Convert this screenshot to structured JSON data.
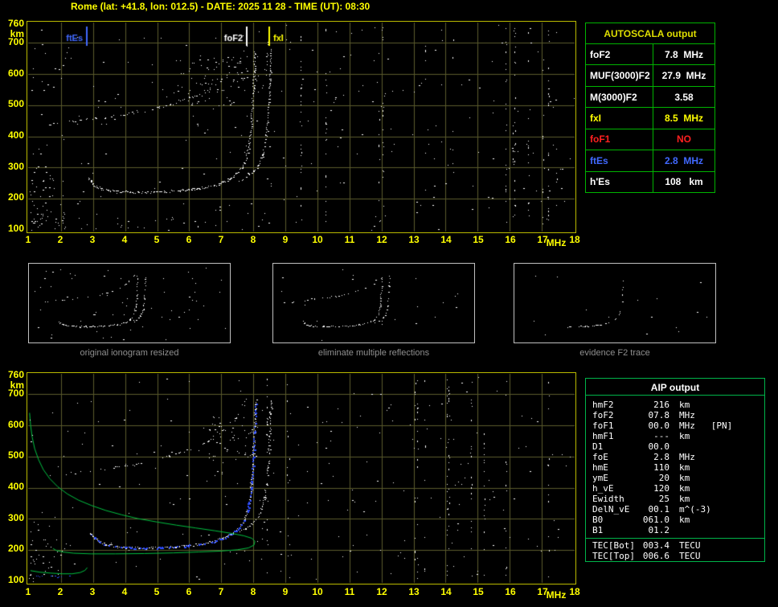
{
  "header": {
    "title": "Rome (lat: +41.8, lon: 012.5) - DATE: 2025 11 28 - TIME (UT): 08:30"
  },
  "autoscala": {
    "title": "AUTOSCALA output",
    "border_color": "#00b400",
    "rows": [
      {
        "label": "foF2",
        "value": "7.8  MHz",
        "color": "#ffffff"
      },
      {
        "label": "MUF(3000)F2",
        "value": "27.9  MHz",
        "color": "#ffffff"
      },
      {
        "label": "M(3000)F2",
        "value": "3.58",
        "color": "#ffffff"
      },
      {
        "label": "fxI",
        "value": "8.5  MHz",
        "color": "#ffff00"
      },
      {
        "label": "foF1",
        "value": "NO",
        "color": "#ff2020"
      },
      {
        "label": "ftEs",
        "value": "2.8  MHz",
        "color": "#4169ff"
      },
      {
        "label": "h'Es",
        "value": "108   km",
        "color": "#ffffff"
      }
    ]
  },
  "thumbnails": {
    "captions": [
      "original ionogram resized",
      "eliminate multiple reflections",
      "evidence F2 trace"
    ]
  },
  "aip": {
    "title": "AIP output",
    "border_color": "#00b44a",
    "rows": [
      {
        "label": "hmF2",
        "value": "216",
        "unit": "km"
      },
      {
        "label": "foF2",
        "value": "07.8",
        "unit": "MHz"
      },
      {
        "label": "foF1",
        "value": "00.0",
        "unit": "MHz   [PN]"
      },
      {
        "label": "hmF1",
        "value": "---",
        "unit": "km"
      },
      {
        "label": "D1",
        "value": "00.0",
        "unit": ""
      },
      {
        "label": "foE",
        "value": "2.8",
        "unit": "MHz"
      },
      {
        "label": "hmE",
        "value": "110",
        "unit": "km"
      },
      {
        "label": "ymE",
        "value": "20",
        "unit": "km"
      },
      {
        "label": "h_vE",
        "value": "120",
        "unit": "km"
      },
      {
        "label": "Ewidth",
        "value": "25",
        "unit": "km"
      },
      {
        "label": "DelN_vE",
        "value": "00.1",
        "unit": "m^(-3)"
      },
      {
        "label": "B0",
        "value": "061.0",
        "unit": "km"
      },
      {
        "label": "B1",
        "value": "01.2",
        "unit": ""
      }
    ],
    "tec_rows": [
      {
        "label": "TEC[Bot]",
        "value": "003.4",
        "unit": "TECU"
      },
      {
        "label": "TEC[Top]",
        "value": "006.6",
        "unit": "TECU"
      }
    ]
  },
  "chart_data": {
    "type": "scatter",
    "title": "ionogram virtual height vs frequency",
    "axes": {
      "xlim": [
        1,
        18
      ],
      "ylim": [
        100,
        760
      ],
      "xticks": [
        1,
        2,
        3,
        4,
        5,
        6,
        7,
        8,
        9,
        10,
        11,
        12,
        13,
        14,
        15,
        16,
        17,
        18
      ],
      "yticks": [
        760,
        700,
        600,
        500,
        400,
        300,
        200,
        100
      ],
      "xunit": "MHz",
      "yunit": "km",
      "grid": true
    },
    "colors": {
      "grid": "#5a5a2c",
      "trace_white": "#ffffff",
      "profile_green": "#00c040",
      "overlay_blue": "#2b4bff",
      "marker_blue": "#4169ff",
      "axis_yellow": "#ffff00",
      "panel_border": "#b9b900"
    },
    "scaled_values": {
      "foF2_MHz": 7.8,
      "fxI_MHz": 8.5,
      "ftEs_MHz": 2.8,
      "hEs_km": 108
    },
    "traces_lib": {
      "main_o": [
        [
          2.85,
          268
        ],
        [
          2.95,
          252
        ],
        [
          3.08,
          241
        ],
        [
          3.25,
          232
        ],
        [
          3.5,
          227
        ],
        [
          3.8,
          224
        ],
        [
          4.2,
          222
        ],
        [
          4.7,
          222
        ],
        [
          5.2,
          224
        ],
        [
          5.7,
          227
        ],
        [
          6.1,
          231
        ],
        [
          6.5,
          237
        ],
        [
          6.85,
          245
        ],
        [
          7.1,
          255
        ],
        [
          7.3,
          267
        ],
        [
          7.5,
          283
        ],
        [
          7.65,
          303
        ],
        [
          7.77,
          330
        ],
        [
          7.85,
          365
        ],
        [
          7.9,
          405
        ],
        [
          7.94,
          455
        ],
        [
          7.97,
          510
        ],
        [
          8.0,
          565
        ],
        [
          8.02,
          620
        ],
        [
          8.04,
          672
        ]
      ],
      "main_x": [
        [
          7.55,
          258
        ],
        [
          7.8,
          272
        ],
        [
          8.0,
          290
        ],
        [
          8.15,
          310
        ],
        [
          8.27,
          338
        ],
        [
          8.35,
          372
        ],
        [
          8.41,
          415
        ],
        [
          8.46,
          468
        ],
        [
          8.49,
          528
        ],
        [
          8.51,
          585
        ],
        [
          8.53,
          640
        ],
        [
          8.55,
          688
        ]
      ],
      "echo": [
        [
          1.6,
          436
        ],
        [
          2.1,
          444
        ],
        [
          2.6,
          452
        ],
        [
          3.1,
          459
        ],
        [
          3.6,
          466
        ],
        [
          4.1,
          474
        ],
        [
          4.6,
          483
        ],
        [
          5.0,
          492
        ],
        [
          5.4,
          503
        ],
        [
          5.8,
          516
        ],
        [
          6.2,
          532
        ],
        [
          6.6,
          551
        ],
        [
          6.9,
          572
        ],
        [
          7.2,
          597
        ],
        [
          7.45,
          625
        ],
        [
          7.65,
          655
        ],
        [
          7.8,
          688
        ]
      ],
      "echo_x": [
        [
          8.25,
          530
        ],
        [
          8.35,
          590
        ],
        [
          8.42,
          648
        ],
        [
          8.47,
          700
        ]
      ],
      "main_b": [
        [
          2.9,
          255
        ],
        [
          3.05,
          238
        ],
        [
          3.2,
          227
        ],
        [
          3.4,
          218
        ],
        [
          3.7,
          212
        ],
        [
          4.1,
          208
        ],
        [
          4.6,
          207
        ],
        [
          5.1,
          208
        ],
        [
          5.6,
          211
        ],
        [
          6.0,
          215
        ],
        [
          6.4,
          221
        ],
        [
          6.8,
          230
        ],
        [
          7.1,
          241
        ],
        [
          7.35,
          255
        ],
        [
          7.55,
          273
        ],
        [
          7.7,
          296
        ],
        [
          7.8,
          325
        ],
        [
          7.88,
          362
        ],
        [
          7.93,
          408
        ],
        [
          7.97,
          462
        ],
        [
          8.0,
          520
        ],
        [
          8.03,
          578
        ],
        [
          8.05,
          635
        ],
        [
          8.07,
          682
        ]
      ],
      "f2_part": [
        [
          4.2,
          223
        ],
        [
          5.0,
          223
        ],
        [
          5.5,
          226
        ],
        [
          6.0,
          230
        ],
        [
          6.5,
          238
        ],
        [
          6.9,
          248
        ],
        [
          7.2,
          260
        ],
        [
          7.5,
          280
        ],
        [
          7.7,
          310
        ],
        [
          7.8,
          345
        ],
        [
          7.88,
          395
        ],
        [
          7.93,
          450
        ],
        [
          7.97,
          510
        ],
        [
          8.0,
          570
        ],
        [
          8.03,
          630
        ]
      ],
      "green_profile": [
        [
          1.02,
          640
        ],
        [
          1.05,
          602
        ],
        [
          1.1,
          563
        ],
        [
          1.18,
          525
        ],
        [
          1.3,
          490
        ],
        [
          1.45,
          458
        ],
        [
          1.65,
          429
        ],
        [
          1.9,
          403
        ],
        [
          2.2,
          380
        ],
        [
          2.55,
          360
        ],
        [
          2.95,
          343
        ],
        [
          3.4,
          327
        ],
        [
          3.9,
          313
        ],
        [
          4.4,
          301
        ],
        [
          5.0,
          290
        ],
        [
          5.6,
          280
        ],
        [
          6.2,
          271
        ],
        [
          6.8,
          262
        ],
        [
          7.3,
          254
        ],
        [
          7.7,
          246
        ],
        [
          7.95,
          238
        ],
        [
          8.05,
          228
        ],
        [
          8.02,
          216
        ],
        [
          7.85,
          207
        ],
        [
          7.5,
          201
        ],
        [
          7.0,
          197
        ],
        [
          6.3,
          194
        ],
        [
          5.5,
          191
        ],
        [
          4.6,
          189
        ],
        [
          3.7,
          188
        ],
        [
          2.95,
          188
        ],
        [
          2.4,
          190
        ],
        [
          2.05,
          194
        ],
        [
          1.85,
          199
        ],
        [
          1.75,
          205
        ]
      ],
      "green_e": [
        [
          1.05,
          134
        ],
        [
          1.35,
          129
        ],
        [
          1.7,
          126
        ],
        [
          2.05,
          124
        ],
        [
          2.35,
          124
        ],
        [
          2.6,
          128
        ],
        [
          2.75,
          135
        ],
        [
          2.82,
          144
        ]
      ],
      "blue_e": [
        [
          1.2,
          119
        ],
        [
          1.6,
          117
        ],
        [
          2.0,
          116
        ],
        [
          2.3,
          116
        ]
      ]
    },
    "panels": [
      {
        "canvas": "c-top",
        "grid": true,
        "traces": [
          {
            "ref": "main_o",
            "color": "#ffffff",
            "density": 0.9,
            "step": 1.6,
            "jitter": 1.3,
            "size": 1,
            "seed": 101
          },
          {
            "ref": "main_x",
            "color": "#ffffff",
            "density": 0.8,
            "step": 2,
            "jitter": 1.2,
            "size": 1,
            "seed": 102
          },
          {
            "ref": "echo",
            "color": "#ffffff",
            "density": 0.5,
            "step": 2.6,
            "jitter": 1.4,
            "size": 1,
            "seed": 103
          },
          {
            "ref": "echo_x",
            "color": "#ffffff",
            "density": 0.45,
            "step": 3,
            "jitter": 1.2,
            "size": 1,
            "seed": 104
          }
        ],
        "clusters": [
          {
            "f": [
              1,
              18
            ],
            "h": [
              100,
              760
            ],
            "n": 240,
            "seed": 11
          },
          {
            "f": [
              1,
              2.1
            ],
            "h": [
              100,
              310
            ],
            "n": 55,
            "seed": 12
          },
          {
            "f": [
              1,
              2.4
            ],
            "h": [
              540,
              760
            ],
            "n": 16,
            "seed": 13
          },
          {
            "f": [
              5.6,
              7.8
            ],
            "h": [
              500,
              660
            ],
            "n": 85,
            "seed": 14
          },
          {
            "f": [
              1,
              8.6
            ],
            "h": [
              102,
              140
            ],
            "n": 26,
            "seed": 15
          }
        ],
        "streaks": {
          "count": 13,
          "f": [
            8.4,
            17.6
          ],
          "m": [
            6,
            26
          ],
          "h": [
            110,
            750
          ],
          "seed": 16
        },
        "markers": [
          {
            "name": "ftEs",
            "f": 2.8,
            "color": "#4169ff",
            "side": "left"
          },
          {
            "name": "foF2",
            "f": 7.8,
            "color": "#ffffff",
            "side": "left"
          },
          {
            "name": "fxI",
            "f": 8.5,
            "color": "#ffff00",
            "side": "right"
          }
        ]
      },
      {
        "canvas": "c-bot",
        "grid": true,
        "traces": [
          {
            "ref": "main_b",
            "color": "#ffffff",
            "density": 0.9,
            "step": 1.6,
            "jitter": 1.3,
            "size": 1,
            "seed": 201
          },
          {
            "ref": "main_x",
            "color": "#ffffff",
            "density": 0.8,
            "step": 2,
            "jitter": 1.2,
            "size": 1,
            "seed": 202
          },
          {
            "ref": "echo",
            "color": "#ffffff",
            "density": 0.4,
            "step": 3,
            "jitter": 1.3,
            "size": 1,
            "seed": 203
          },
          {
            "ref": "main_b",
            "color": "#2b4bff",
            "density": 0.5,
            "step": 2.4,
            "jitter": 1.1,
            "size": 2,
            "seed": 204
          },
          {
            "ref": "green_profile",
            "color": "#00c040",
            "mode": "line"
          },
          {
            "ref": "green_e",
            "color": "#00c040",
            "mode": "line"
          },
          {
            "ref": "blue_e",
            "color": "#2b4bff",
            "density": 0.6,
            "step": 2.5,
            "jitter": 1,
            "size": 1,
            "seed": 205
          }
        ],
        "clusters": [
          {
            "f": [
              1,
              18
            ],
            "h": [
              100,
              760
            ],
            "n": 220,
            "seed": 21
          },
          {
            "f": [
              1,
              2.1
            ],
            "h": [
              100,
              300
            ],
            "n": 35,
            "seed": 22
          },
          {
            "f": [
              6.6,
              8.2
            ],
            "h": [
              480,
              630
            ],
            "n": 55,
            "seed": 23
          }
        ],
        "streaks": {
          "count": 12,
          "f": [
            8.4,
            17.6
          ],
          "m": [
            5,
            22
          ],
          "h": [
            110,
            750
          ],
          "seed": 26
        },
        "markers": []
      },
      {
        "canvas": "c-th1",
        "grid": false,
        "xlim": [
          1,
          14
        ],
        "traces": [
          {
            "ref": "main_o",
            "color": "#ffffff",
            "density": 0.75,
            "step": 2.2,
            "jitter": 0.8,
            "size": 1,
            "seed": 301
          },
          {
            "ref": "main_x",
            "color": "#ffffff",
            "density": 0.6,
            "step": 2.5,
            "jitter": 0.8,
            "size": 1,
            "seed": 302
          },
          {
            "ref": "echo",
            "color": "#ffffff",
            "density": 0.45,
            "step": 3,
            "jitter": 0.8,
            "size": 1,
            "seed": 303
          }
        ],
        "clusters": [
          {
            "f": [
              1,
              14
            ],
            "h": [
              100,
              760
            ],
            "n": 60,
            "seed": 31
          }
        ]
      },
      {
        "canvas": "c-th2",
        "grid": false,
        "xlim": [
          1,
          14
        ],
        "traces": [
          {
            "ref": "main_o",
            "color": "#ffffff",
            "density": 0.75,
            "step": 2.2,
            "jitter": 0.8,
            "size": 1,
            "seed": 401
          },
          {
            "ref": "main_x",
            "color": "#ffffff",
            "density": 0.55,
            "step": 2.5,
            "jitter": 0.8,
            "size": 1,
            "seed": 402
          },
          {
            "ref": "echo",
            "color": "#ffffff",
            "density": 0.35,
            "step": 3.2,
            "jitter": 0.8,
            "size": 1,
            "seed": 403
          }
        ],
        "clusters": [
          {
            "f": [
              1,
              14
            ],
            "h": [
              100,
              760
            ],
            "n": 25,
            "seed": 41
          }
        ]
      },
      {
        "canvas": "c-th3",
        "grid": false,
        "xlim": [
          1,
          14
        ],
        "traces": [
          {
            "ref": "f2_part",
            "color": "#ffffff",
            "density": 0.55,
            "step": 2.6,
            "jitter": 0.8,
            "size": 1,
            "seed": 501
          }
        ],
        "clusters": [
          {
            "f": [
              1,
              14
            ],
            "h": [
              100,
              760
            ],
            "n": 15,
            "seed": 51
          }
        ]
      }
    ]
  }
}
